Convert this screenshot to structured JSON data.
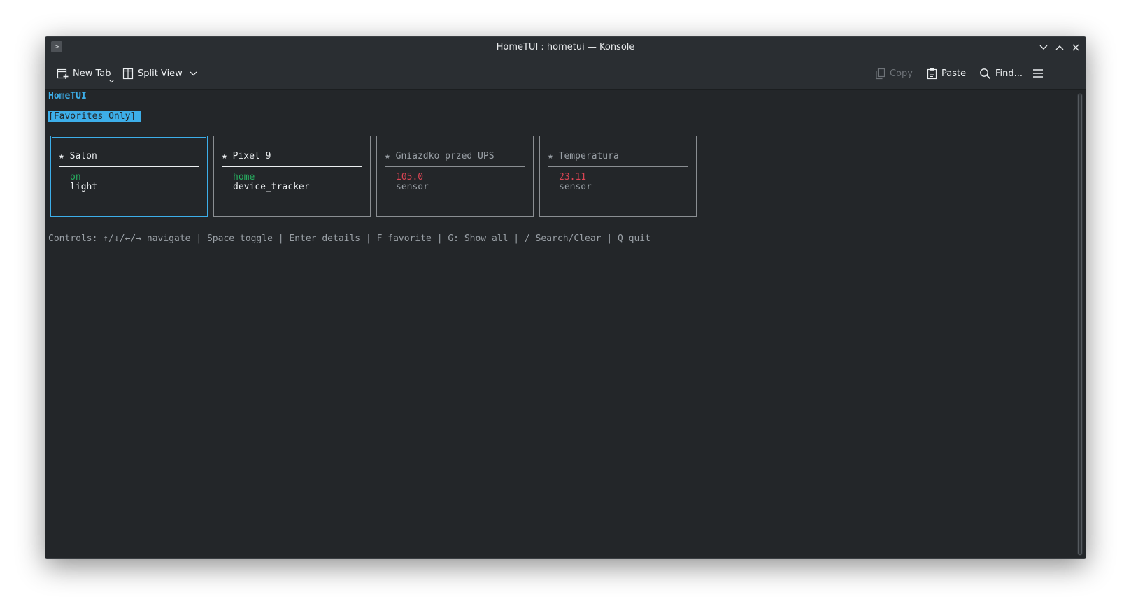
{
  "window": {
    "title": "HomeTUI : hometui — Konsole"
  },
  "toolbar": {
    "new_tab": "New Tab",
    "split_view": "Split View",
    "copy": "Copy",
    "paste": "Paste",
    "find": "Find..."
  },
  "terminal": {
    "app_title": "HomeTUI",
    "filter_badge": "[Favorites Only]",
    "cards": [
      {
        "title": "★ Salon",
        "state": "on",
        "type": "light",
        "state_color": "#27ae60",
        "selected": true,
        "dim": false
      },
      {
        "title": "★ Pixel 9",
        "state": "home",
        "type": "device_tracker",
        "state_color": "#27ae60",
        "selected": false,
        "dim": false
      },
      {
        "title": "★ Gniazdko przed UPS",
        "state": "105.0",
        "type": "sensor",
        "state_color": "#da4453",
        "selected": false,
        "dim": true
      },
      {
        "title": "★ Temperatura",
        "state": "23.11",
        "type": "sensor",
        "state_color": "#da4453",
        "selected": false,
        "dim": true
      }
    ],
    "controls": "Controls: ↑/↓/←/→ navigate | Space toggle | Enter details | F favorite | G: Show all | / Search/Clear | Q quit"
  },
  "colors": {
    "accent": "#3daee9",
    "on_state": "#27ae60",
    "sensor_value": "#da4453",
    "background": "#232629"
  }
}
